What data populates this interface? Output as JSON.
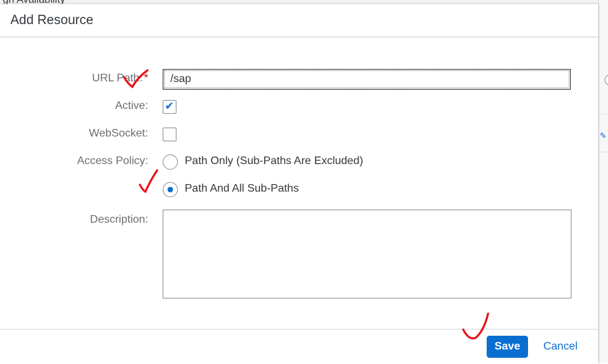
{
  "background": {
    "partial_text": "gh Availability"
  },
  "dialog": {
    "title": "Add Resource",
    "fields": {
      "url_path": {
        "label": "URL Path:",
        "required_marker": "*",
        "value": "/sap"
      },
      "active": {
        "label": "Active:",
        "checked": true
      },
      "websocket": {
        "label": "WebSocket:",
        "checked": false
      },
      "access_policy": {
        "label": "Access Policy:",
        "options": [
          "Path Only (Sub-Paths Are Excluded)",
          "Path And All Sub-Paths"
        ],
        "selected": "Path And All Sub-Paths"
      },
      "description": {
        "label": "Description:",
        "value": ""
      }
    },
    "footer": {
      "save_label": "Save",
      "cancel_label": "Cancel"
    }
  },
  "colors": {
    "accent": "#0a6ed1",
    "required": "#bb0000",
    "annotation": "#e8131a"
  },
  "icons": {
    "checkmark": "check-icon",
    "handwritten": "red-check-annotation"
  }
}
